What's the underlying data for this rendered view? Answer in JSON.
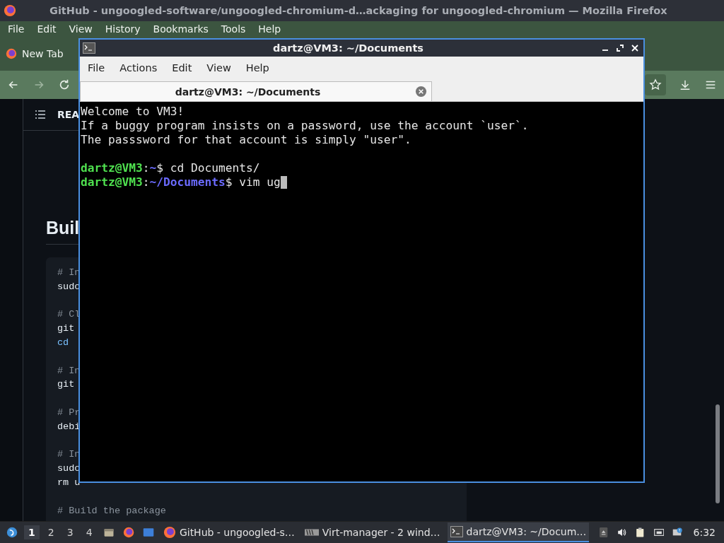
{
  "firefox": {
    "title": "GitHub - ungoogled-software/ungoogled-chromium-d…ackaging for ungoogled-chromium — Mozilla Firefox",
    "menu": [
      "File",
      "Edit",
      "View",
      "History",
      "Bookmarks",
      "Tools",
      "Help"
    ],
    "tab": {
      "label": "New Tab"
    },
    "page": {
      "toc_label": "REA",
      "heading": "Buil",
      "code_lines": [
        {
          "kind": "code",
          "parts": [
            {
              "kind": "comment",
              "text": "# In"
            }
          ]
        },
        {
          "kind": "code",
          "parts": [
            {
              "kind": "plain",
              "text": "sudo"
            }
          ]
        },
        {
          "kind": "blank"
        },
        {
          "kind": "code",
          "parts": [
            {
              "kind": "comment",
              "text": "# Cl"
            }
          ]
        },
        {
          "kind": "code",
          "parts": [
            {
              "kind": "plain",
              "text": "git"
            }
          ]
        },
        {
          "kind": "code",
          "parts": [
            {
              "kind": "builtin",
              "text": "cd"
            }
          ]
        },
        {
          "kind": "blank"
        },
        {
          "kind": "code",
          "parts": [
            {
              "kind": "comment",
              "text": "# In"
            }
          ]
        },
        {
          "kind": "code",
          "parts": [
            {
              "kind": "plain",
              "text": "git"
            }
          ]
        },
        {
          "kind": "blank"
        },
        {
          "kind": "code",
          "parts": [
            {
              "kind": "comment",
              "text": "# Pr"
            }
          ]
        },
        {
          "kind": "code",
          "parts": [
            {
              "kind": "plain",
              "text": "debi"
            }
          ]
        },
        {
          "kind": "blank"
        },
        {
          "kind": "code",
          "parts": [
            {
              "kind": "comment",
              "text": "# In"
            }
          ]
        },
        {
          "kind": "code",
          "parts": [
            {
              "kind": "plain",
              "text": "sudo"
            }
          ]
        },
        {
          "kind": "code",
          "parts": [
            {
              "kind": "plain",
              "text": "rm u"
            }
          ]
        },
        {
          "kind": "blank"
        },
        {
          "kind": "code",
          "parts": [
            {
              "kind": "comment",
              "text": "# Build the package"
            }
          ]
        }
      ]
    }
  },
  "terminal": {
    "title": "dartz@VM3: ~/Documents",
    "menu": [
      "File",
      "Actions",
      "Edit",
      "View",
      "Help"
    ],
    "tab": {
      "label": "dartz@VM3: ~/Documents"
    },
    "lines": [
      {
        "kind": "text",
        "text": "Welcome to VM3!"
      },
      {
        "kind": "text",
        "text": "If a buggy program insists on a password, use the account `user`."
      },
      {
        "kind": "text",
        "text": "The passsword for that account is simply \"user\"."
      },
      {
        "kind": "blank"
      },
      {
        "kind": "prompt",
        "user": "dartz@VM3",
        "sep": ":",
        "path": "~",
        "symbol": "$",
        "command": "cd Documents/",
        "cursor": false
      },
      {
        "kind": "prompt",
        "user": "dartz@VM3",
        "sep": ":",
        "path": "~/Documents",
        "symbol": "$",
        "command": "vim ug",
        "cursor": true
      }
    ]
  },
  "taskbar": {
    "workspaces": [
      {
        "label": "1",
        "selected": true
      },
      {
        "label": "2",
        "selected": false
      },
      {
        "label": "3",
        "selected": false
      },
      {
        "label": "4",
        "selected": false
      }
    ],
    "tasks": [
      {
        "kind": "browser",
        "label": "GitHub - ungoogled-s…",
        "selected": false
      },
      {
        "kind": "virt",
        "label": "Virt-manager - 2 wind…",
        "selected": false
      },
      {
        "kind": "terminal",
        "label": "dartz@VM3: ~/Docum…",
        "selected": true
      }
    ],
    "clock": "6:32"
  }
}
